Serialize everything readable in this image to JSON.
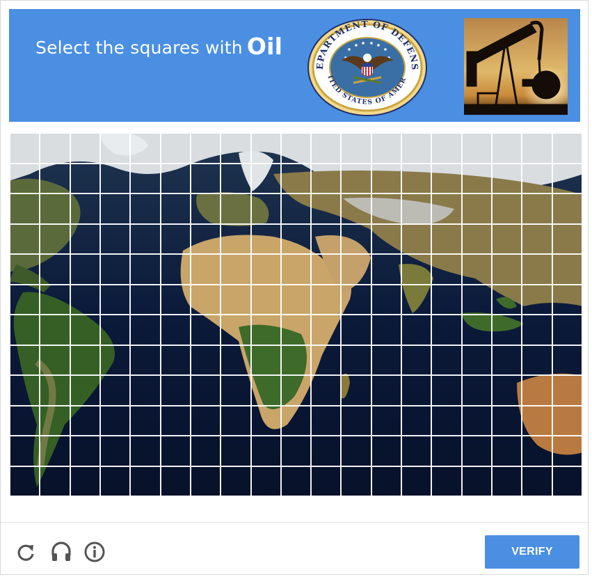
{
  "header": {
    "instruction": "Select the squares with",
    "target": "Oil",
    "seal_text_top": "DEPARTMENT OF DEFENSE",
    "seal_text_bottom": "UNITED STATES OF AMERICA",
    "background_color": "#4a8fe2"
  },
  "grid": {
    "columns": 19,
    "rows": 12,
    "image": "world-satellite-map"
  },
  "footer": {
    "icons": [
      "reload-icon",
      "audio-headphones-icon",
      "info-icon"
    ],
    "verify_label": "VERIFY",
    "button_color": "#4a8fe2"
  }
}
